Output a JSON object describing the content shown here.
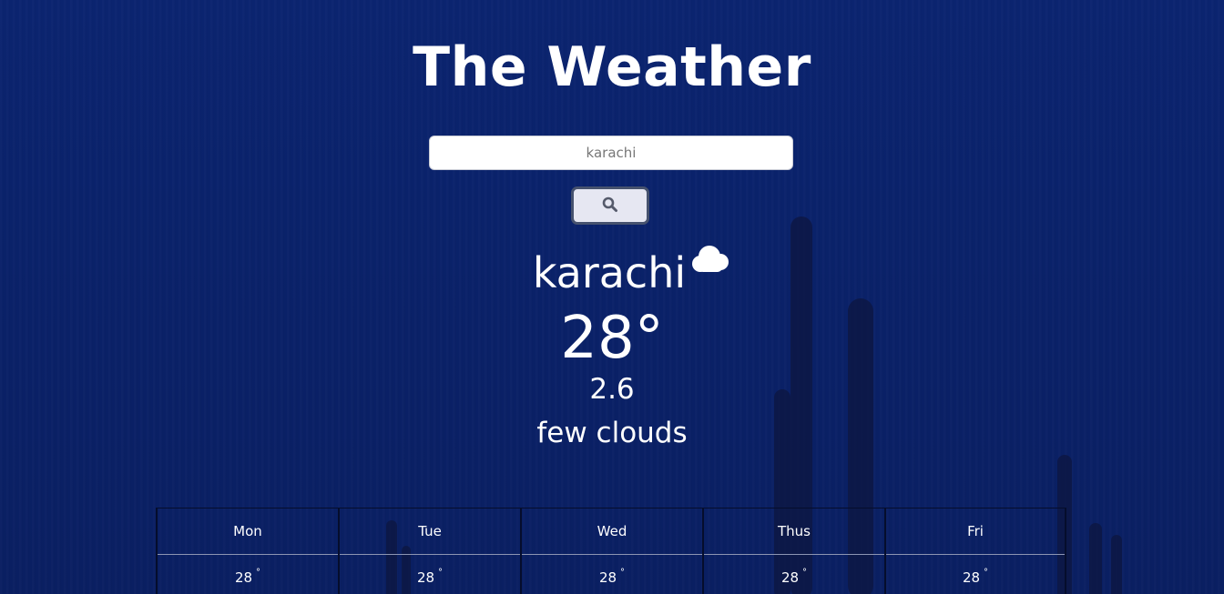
{
  "header": {
    "title": "The Weather"
  },
  "search": {
    "placeholder": "karachi",
    "value": ""
  },
  "current": {
    "city": "karachi",
    "icon": "cloud-icon",
    "temperature": "28°",
    "wind": "2.6",
    "description": "few clouds"
  },
  "forecast": [
    {
      "day": "Mon",
      "temp": "28",
      "deg": "°"
    },
    {
      "day": "Tue",
      "temp": "28",
      "deg": "°"
    },
    {
      "day": "Wed",
      "temp": "28",
      "deg": "°"
    },
    {
      "day": "Thus",
      "temp": "28",
      "deg": "°"
    },
    {
      "day": "Fri",
      "temp": "28",
      "deg": "°"
    }
  ],
  "colors": {
    "background": "#0a2169",
    "text": "#ffffff",
    "input_bg": "#ffffff",
    "button_bg": "#e6e7f2"
  }
}
